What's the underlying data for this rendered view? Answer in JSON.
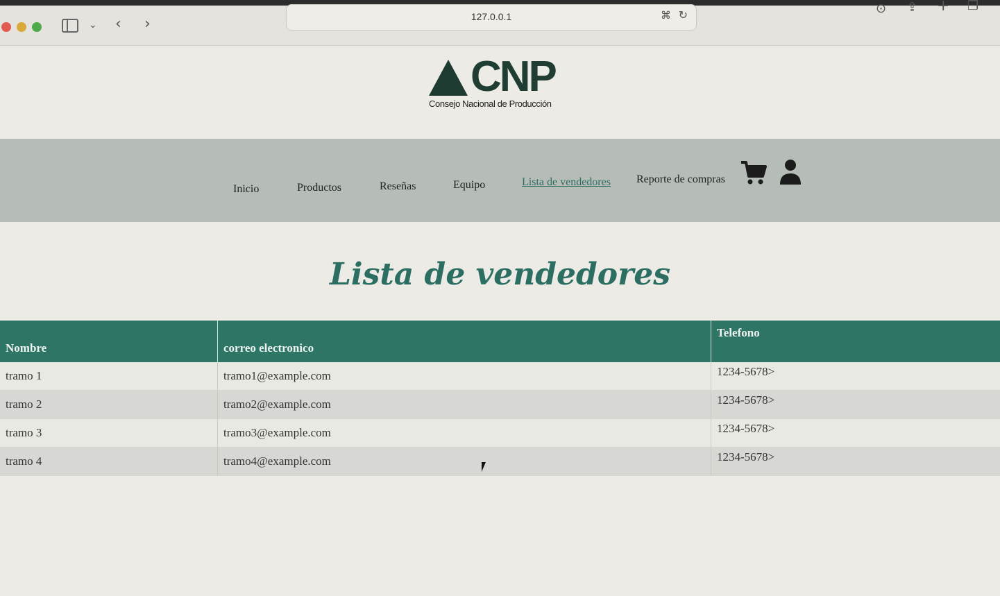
{
  "browser": {
    "url": "127.0.0.1",
    "colors": {
      "close": "#e25b52",
      "minimize": "#d9aa3b",
      "maximize": "#4faa4b"
    }
  },
  "logo": {
    "text": "CNP",
    "subtitle": "Consejo Nacional de Producción"
  },
  "nav": {
    "items": [
      {
        "label": "Inicio"
      },
      {
        "label": "Productos"
      },
      {
        "label": "Reseñas"
      },
      {
        "label": "Equipo"
      },
      {
        "label": "Lista de vendedores",
        "active": true
      },
      {
        "label": "Reporte de compras"
      }
    ]
  },
  "page": {
    "title": "Lista de vendedores"
  },
  "table": {
    "headers": [
      "Nombre",
      "correo electronico",
      "Telefono"
    ],
    "rows": [
      [
        "tramo 1",
        "tramo1@example.com",
        "1234-5678>"
      ],
      [
        "tramo 2",
        "tramo2@example.com",
        "1234-5678>"
      ],
      [
        "tramo 3",
        "tramo3@example.com",
        "1234-5678>"
      ],
      [
        "tramo 4",
        "tramo4@example.com",
        "1234-5678>"
      ]
    ]
  },
  "theme": {
    "accent": "#2f7566",
    "nav_bg": "#b6bdb7"
  }
}
